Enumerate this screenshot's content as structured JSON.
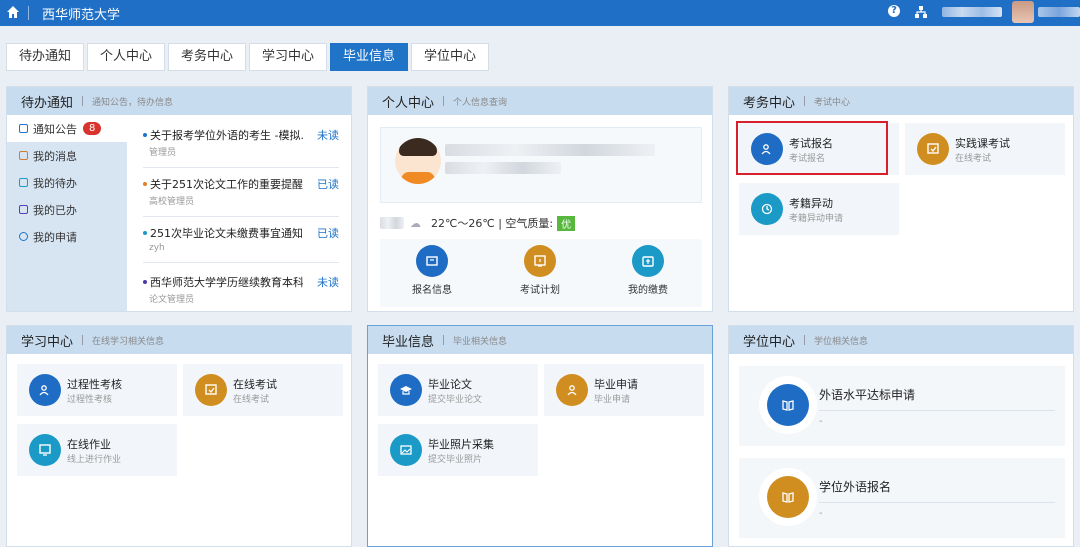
{
  "topbar": {
    "title": "西华师范大学"
  },
  "tabs": [
    "待办通知",
    "个人中心",
    "考务中心",
    "学习中心",
    "毕业信息",
    "学位中心"
  ],
  "todo": {
    "title": "待办通知",
    "sub": "通知公告，待办信息",
    "side": [
      {
        "label": "通知公告",
        "badge": "8"
      },
      {
        "label": "我的消息"
      },
      {
        "label": "我的待办"
      },
      {
        "label": "我的已办"
      },
      {
        "label": "我的申请"
      }
    ],
    "notices": [
      {
        "title": "关于报考学位外语的考生 -模拟...",
        "author": "管理员",
        "status": "未读",
        "dot": "#1f74c8"
      },
      {
        "title": "关于251次论文工作的重要提醒",
        "author": "高校管理员",
        "status": "已读",
        "dot": "#e0812a"
      },
      {
        "title": "251次毕业论文未缴费事宜通知",
        "author": "zyh",
        "status": "已读",
        "dot": "#1c9ac7"
      },
      {
        "title": "西华师范大学学历继续教育本科...",
        "author": "论文管理员",
        "status": "未读",
        "dot": "#4a3aa8"
      }
    ]
  },
  "personal": {
    "title": "个人中心",
    "sub": "个人信息查询",
    "weather": "22℃～26℃ | 空气质量:",
    "air": "优",
    "items": [
      "报名信息",
      "考试计划",
      "我的缴费"
    ]
  },
  "exam": {
    "title": "考务中心",
    "sub": "考试中心",
    "tiles": [
      {
        "t": "考试报名",
        "s": "考试报名"
      },
      {
        "t": "实践课考试",
        "s": "在线考试"
      },
      {
        "t": "考籍异动",
        "s": "考籍异动申请"
      }
    ]
  },
  "study": {
    "title": "学习中心",
    "sub": "在线学习相关信息",
    "tiles": [
      {
        "t": "过程性考核",
        "s": "过程性考核"
      },
      {
        "t": "在线考试",
        "s": "在线考试"
      },
      {
        "t": "在线作业",
        "s": "线上进行作业"
      }
    ]
  },
  "grad": {
    "title": "毕业信息",
    "sub": "毕业相关信息",
    "tiles": [
      {
        "t": "毕业论文",
        "s": "提交毕业论文"
      },
      {
        "t": "毕业申请",
        "s": "毕业申请"
      },
      {
        "t": "毕业照片采集",
        "s": "提交毕业照片"
      }
    ]
  },
  "degree": {
    "title": "学位中心",
    "sub": "学位相关信息",
    "items": [
      {
        "t": "外语水平达标申请",
        "d": "-"
      },
      {
        "t": "学位外语报名",
        "d": "-"
      }
    ]
  }
}
